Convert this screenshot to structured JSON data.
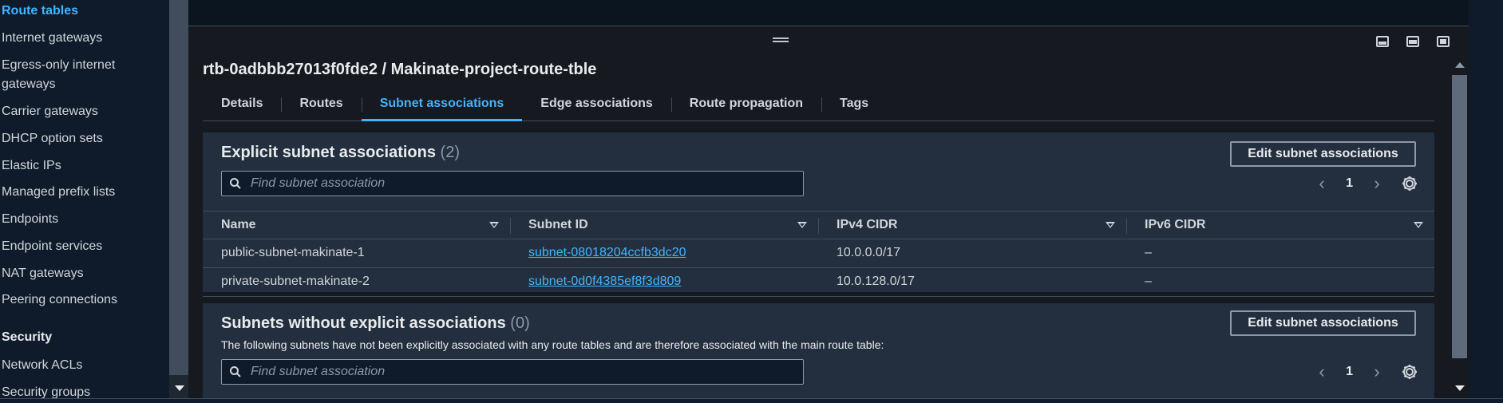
{
  "sidebar": {
    "items": [
      {
        "label": "Route tables",
        "active": true
      },
      {
        "label": "Internet gateways"
      },
      {
        "label": "Egress-only internet gateways"
      },
      {
        "label": "Carrier gateways"
      },
      {
        "label": "DHCP option sets"
      },
      {
        "label": "Elastic IPs"
      },
      {
        "label": "Managed prefix lists"
      },
      {
        "label": "Endpoints"
      },
      {
        "label": "Endpoint services"
      },
      {
        "label": "NAT gateways"
      },
      {
        "label": "Peering connections"
      }
    ],
    "security_section": {
      "title": "Security",
      "items": [
        {
          "label": "Network ACLs"
        },
        {
          "label": "Security groups"
        }
      ]
    }
  },
  "panel": {
    "title": "rtb-0adbbb27013f0fde2 / Makinate-project-route-tble",
    "tabs": [
      {
        "label": "Details"
      },
      {
        "label": "Routes"
      },
      {
        "label": "Subnet associations",
        "active": true
      },
      {
        "label": "Edge associations"
      },
      {
        "label": "Route propagation"
      },
      {
        "label": "Tags"
      }
    ]
  },
  "explicit": {
    "title": "Explicit subnet associations",
    "count": "(2)",
    "edit_label": "Edit subnet associations",
    "search_placeholder": "Find subnet association",
    "page": "1",
    "columns": [
      "Name",
      "Subnet ID",
      "IPv4 CIDR",
      "IPv6 CIDR"
    ],
    "rows": [
      {
        "name": "public-subnet-makinate-1",
        "subnet_id": "subnet-08018204ccfb3dc20",
        "ipv4": "10.0.0.0/17",
        "ipv6": "–"
      },
      {
        "name": "private-subnet-makinate-2",
        "subnet_id": "subnet-0d0f4385ef8f3d809",
        "ipv4": "10.0.128.0/17",
        "ipv6": "–"
      }
    ]
  },
  "without": {
    "title": "Subnets without explicit associations",
    "count": "(0)",
    "description": "The following subnets have not been explicitly associated with any route tables and are therefore associated with the main route table:",
    "edit_label": "Edit subnet associations",
    "search_placeholder": "Find subnet association",
    "page": "1"
  },
  "colors": {
    "accent": "#42b4ff",
    "background": "#16191f",
    "container": "#232f3e"
  }
}
